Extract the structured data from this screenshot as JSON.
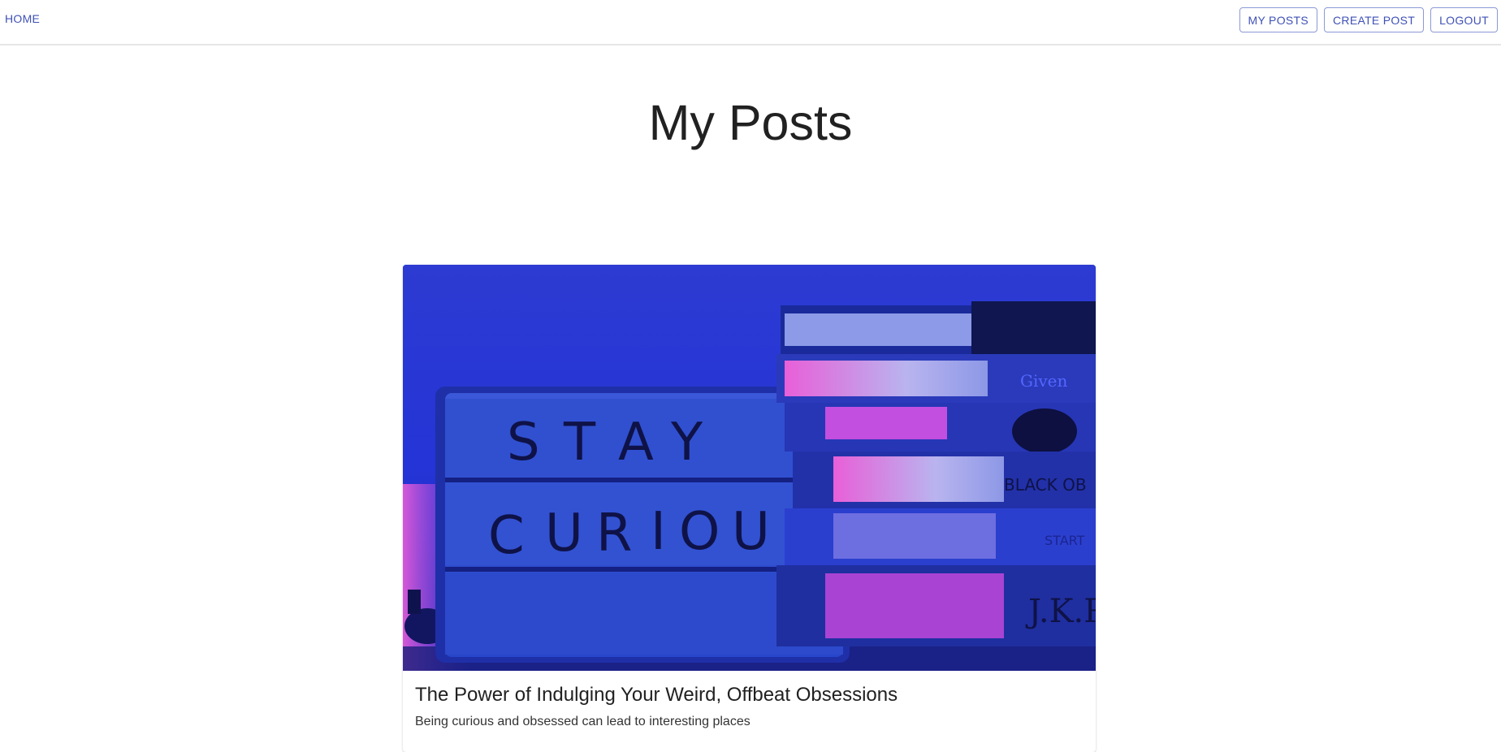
{
  "nav": {
    "home_label": "HOME",
    "my_posts_label": "MY POSTS",
    "create_post_label": "CREATE POST",
    "logout_label": "LOGOUT"
  },
  "page": {
    "title": "My Posts"
  },
  "posts": [
    {
      "image_description": "Lightbox sign next to a stack of books under blue and pink light",
      "image_sign_lines": [
        "STAY",
        "CURIOUS"
      ],
      "title": "The Power of Indulging Your Weird, Offbeat Obsessions",
      "description": "Being curious and obsessed can lead to interesting places"
    }
  ],
  "colors": {
    "accent": "#3f51b5",
    "image_blue": "#2535d4",
    "image_pink": "#d94fd1"
  }
}
